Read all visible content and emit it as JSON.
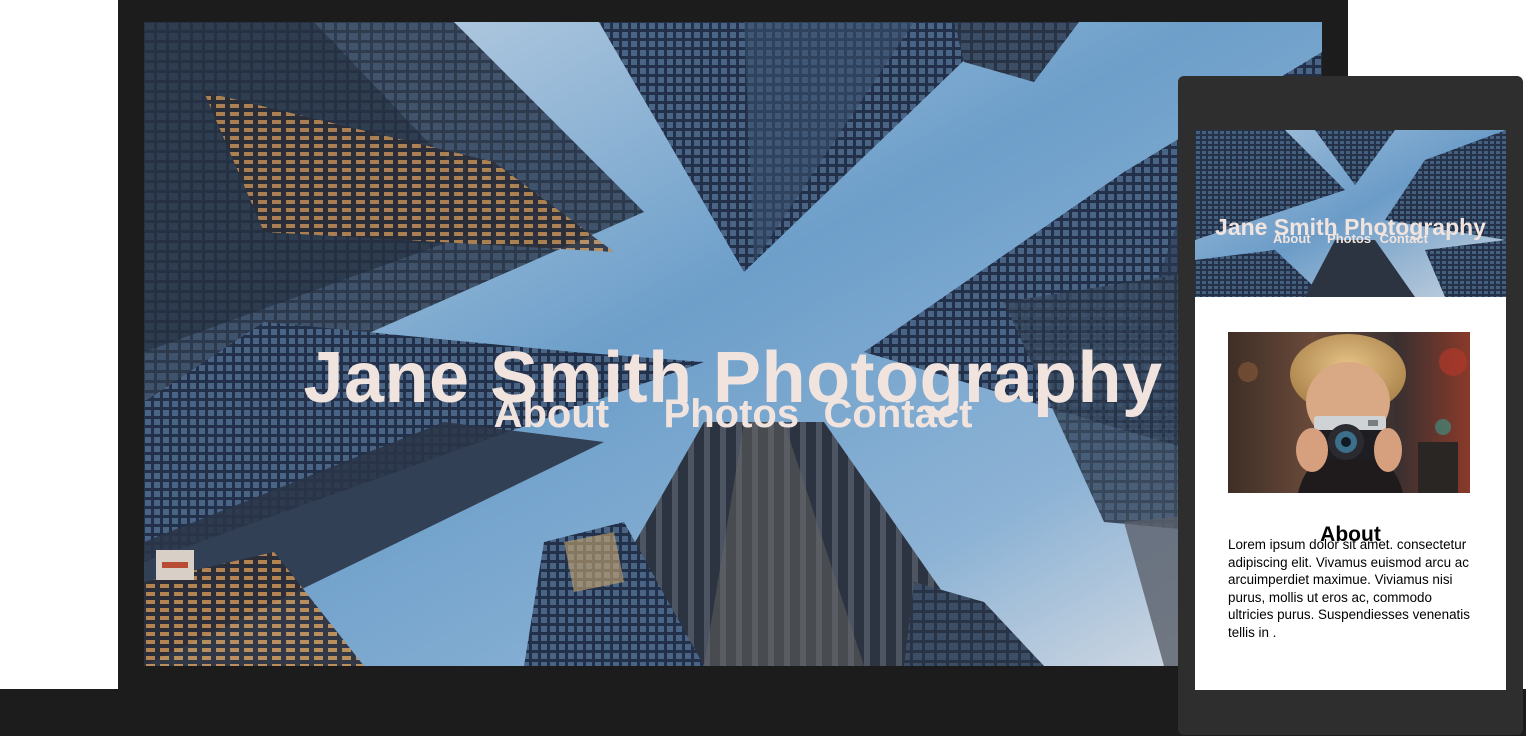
{
  "desktop": {
    "site_title": "Jane Smith Photography",
    "nav": [
      {
        "label": "About"
      },
      {
        "label": "Photos"
      },
      {
        "label": "Contact"
      }
    ]
  },
  "mobile": {
    "site_title": "Jane Smith Photography",
    "nav": [
      {
        "label": "About"
      },
      {
        "label": "Photos"
      },
      {
        "label": "Contact"
      }
    ],
    "about": {
      "heading": "About",
      "body": "Lorem ipsum dolor sit amet. consectetur adipiscing elit. Vivamus euismod arcu ac arcuimperdiet maximue. Viviamus nisi purus, mollis ut eros ac, commodo ultricies purus. Suspendiesses venenatis tellis in ."
    }
  },
  "colors": {
    "device_frame": "#1c1c1c",
    "phone_frame": "#2e2e2e",
    "hero_text": "#f1e4df",
    "sky_top": "#b9cfe2",
    "sky_middle": "#6c9fcb",
    "sky_bottom": "#dadde3"
  },
  "icons": {
    "hero_background": "skyscrapers-photo",
    "about_image": "photographer-with-camera-photo"
  }
}
